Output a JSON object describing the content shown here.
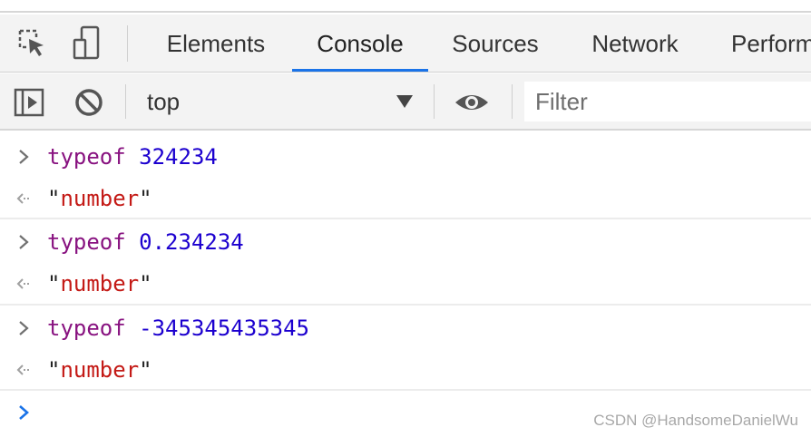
{
  "tabs": [
    {
      "label": "Elements"
    },
    {
      "label": "Console",
      "active": true
    },
    {
      "label": "Sources"
    },
    {
      "label": "Network"
    },
    {
      "label": "Perform"
    }
  ],
  "toolbar": {
    "context": "top",
    "filter_placeholder": "Filter"
  },
  "console": {
    "entries": [
      {
        "input": {
          "keyword": "typeof",
          "space": " ",
          "prefix": "",
          "value": "324234"
        },
        "output": {
          "q1": "\"",
          "text": "number",
          "q2": "\""
        }
      },
      {
        "input": {
          "keyword": "typeof",
          "space": " ",
          "prefix": "",
          "value": "0.234234"
        },
        "output": {
          "q1": "\"",
          "text": "number",
          "q2": "\""
        }
      },
      {
        "input": {
          "keyword": "typeof",
          "space": " ",
          "prefix": "-",
          "value": "345345435345"
        },
        "output": {
          "q1": "\"",
          "text": "number",
          "q2": "\""
        }
      }
    ]
  },
  "watermark": "CSDN @HandsomeDanielWu",
  "colors": {
    "keyword": "#881280",
    "number": "#1c00cf",
    "string": "#c41a16",
    "accent": "#1a73e8"
  },
  "icons": [
    "inspect-element-icon",
    "device-toolbar-icon",
    "toggle-sidebar-icon",
    "clear-console-icon",
    "dropdown-arrow-icon",
    "live-expression-eye-icon",
    "input-chevron-icon",
    "output-arrow-icon",
    "prompt-chevron-icon"
  ]
}
